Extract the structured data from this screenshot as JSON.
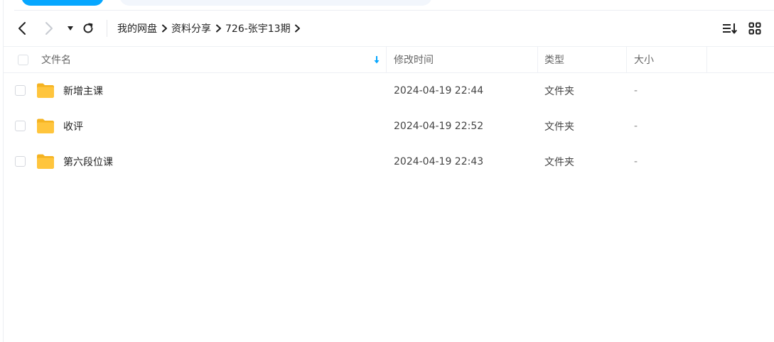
{
  "breadcrumb": {
    "items": [
      "我的网盘",
      "资料分享",
      "726-张宇13期"
    ]
  },
  "table": {
    "headers": {
      "name": "文件名",
      "modified": "修改时间",
      "type": "类型",
      "size": "大小"
    },
    "sort_indicator": "sort-down-icon",
    "rows": [
      {
        "name": "新增主课",
        "modified": "2024-04-19 22:44",
        "type": "文件夹",
        "size": "-"
      },
      {
        "name": "收评",
        "modified": "2024-04-19 22:52",
        "type": "文件夹",
        "size": "-"
      },
      {
        "name": "第六段位课",
        "modified": "2024-04-19 22:43",
        "type": "文件夹",
        "size": "-"
      }
    ]
  },
  "colors": {
    "accent": "#06a7ff",
    "folder": "#ffc53d"
  },
  "icons": {
    "back": "chevron-left-icon",
    "forward": "chevron-right-icon",
    "history": "caret-down-icon",
    "refresh": "refresh-icon",
    "breadcrumb_separator": "chevron-right-icon",
    "sort_view": "sort-list-icon",
    "grid_view": "grid-view-icon",
    "folder": "folder-icon"
  }
}
